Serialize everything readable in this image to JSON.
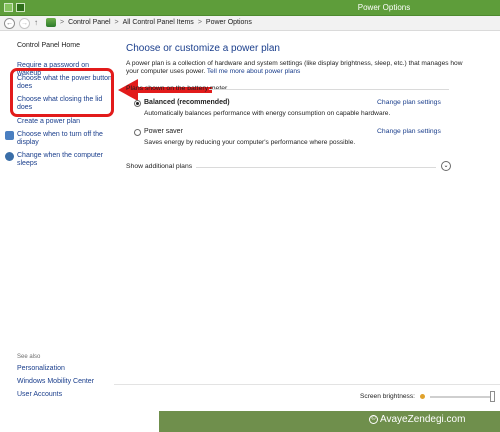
{
  "window": {
    "title": "Power Options"
  },
  "address": {
    "crumbs": [
      "Control Panel",
      "All Control Panel Items",
      "Power Options"
    ],
    "separator": ">"
  },
  "sidebar": {
    "home": "Control Panel Home",
    "items": [
      "Require a password on wakeup",
      "Choose what the power button does",
      "Choose what closing the lid does",
      "Create a power plan",
      "Choose when to turn off the display",
      "Change when the computer sleeps"
    ],
    "see_also_title": "See also",
    "see_also": [
      "Personalization",
      "Windows Mobility Center",
      "User Accounts"
    ]
  },
  "main": {
    "heading": "Choose or customize a power plan",
    "description": "A power plan is a collection of hardware and system settings (like display brightness, sleep, etc.) that manages how your computer uses power.",
    "more_link": "Tell me more about power plans",
    "group_label": "Plans shown on the battery meter",
    "plans": [
      {
        "name": "Balanced (recommended)",
        "description": "Automatically balances performance with energy consumption on capable hardware.",
        "change": "Change plan settings",
        "selected": true
      },
      {
        "name": "Power saver",
        "description": "Saves energy by reducing your computer's performance where possible.",
        "change": "Change plan settings",
        "selected": false
      }
    ],
    "show_additional": "Show additional plans"
  },
  "footer": {
    "brightness_label": "Screen brightness:",
    "brightness_level": 0.98
  },
  "watermark": "AvayeZendegi.com",
  "colors": {
    "accent": "#5e9d3a",
    "link": "#1a3e8c",
    "highlight": "#e21b1b"
  },
  "icons": {
    "back": "back-arrow-icon",
    "forward": "forward-arrow-icon",
    "up": "up-arrow-icon",
    "control_panel": "control-panel-icon",
    "expand": "chevron-down-icon"
  }
}
